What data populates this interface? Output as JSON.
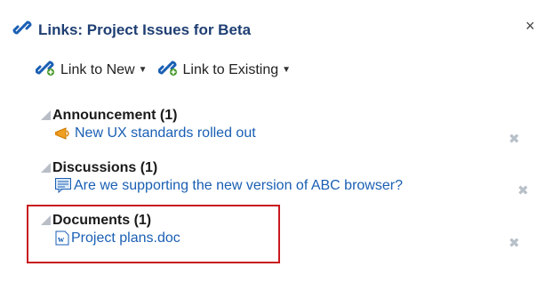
{
  "header": {
    "title": "Links: Project Issues for Beta",
    "close_label": "×"
  },
  "toolbar": {
    "link_new_label": "Link to New",
    "link_existing_label": "Link to Existing"
  },
  "groups": [
    {
      "title": "Announcement (1)",
      "items": [
        {
          "label": "New UX standards rolled out",
          "icon": "megaphone-icon"
        }
      ]
    },
    {
      "title": "Discussions (1)",
      "items": [
        {
          "label": "Are we supporting the new version of ABC browser?",
          "icon": "discussion-icon"
        }
      ]
    },
    {
      "title": "Documents (1)",
      "items": [
        {
          "label": "Project plans.doc",
          "icon": "word-document-icon"
        }
      ]
    }
  ],
  "delete_label": "✖",
  "colors": {
    "title": "#1f3f73",
    "link": "#1a5fb4",
    "highlight_border": "#c8191e",
    "delete_icon": "#b8c0c9"
  }
}
